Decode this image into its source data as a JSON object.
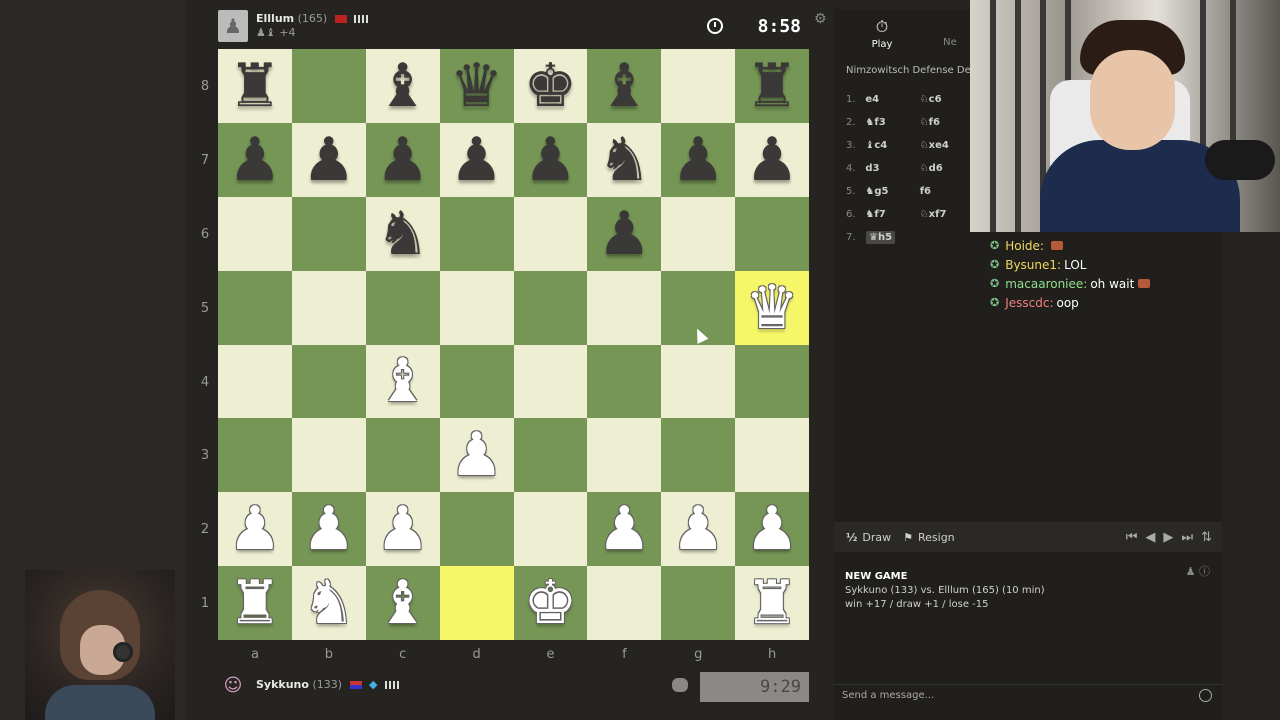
{
  "top_player": {
    "name": "Elllum",
    "rating": "(165)",
    "captures": "♟♝",
    "material": "+4"
  },
  "bottom_player": {
    "name": "Sykkuno",
    "rating": "(133)"
  },
  "clocks": {
    "top": "8:58",
    "bottom": "9:29"
  },
  "board": {
    "ranks": [
      "8",
      "7",
      "6",
      "5",
      "4",
      "3",
      "2",
      "1"
    ],
    "files": [
      "a",
      "b",
      "c",
      "d",
      "e",
      "f",
      "g",
      "h"
    ],
    "rows": [
      [
        "bR",
        "",
        "bB",
        "bQ",
        "bK",
        "bB",
        "",
        "bR"
      ],
      [
        "bP",
        "bP",
        "bP",
        "bP",
        "bP",
        "bN",
        "bP",
        "bP"
      ],
      [
        "",
        "",
        "bN",
        "",
        "",
        "bP",
        "",
        ""
      ],
      [
        "",
        "",
        "",
        "",
        "",
        "",
        "",
        "wQ"
      ],
      [
        "",
        "",
        "wB",
        "",
        "",
        "",
        "",
        ""
      ],
      [
        "",
        "",
        "",
        "wP",
        "",
        "",
        "",
        ""
      ],
      [
        "wP",
        "wP",
        "wP",
        "",
        "",
        "wP",
        "wP",
        "wP"
      ],
      [
        "wR",
        "wN",
        "wB",
        "",
        "wK",
        "",
        "",
        "wR"
      ]
    ],
    "highlights": [
      "h5",
      "d1"
    ]
  },
  "tabs": {
    "play": "Play",
    "new": "Ne"
  },
  "opening": "Nimzowitsch Defense Declin",
  "moves": [
    {
      "n": "1.",
      "w": "e4",
      "b": "♘c6"
    },
    {
      "n": "2.",
      "w": "♞f3",
      "b": "♘f6"
    },
    {
      "n": "3.",
      "w": "♝c4",
      "b": "♘xe4"
    },
    {
      "n": "4.",
      "w": "d3",
      "b": "♘d6"
    },
    {
      "n": "5.",
      "w": "♞g5",
      "b": "f6"
    },
    {
      "n": "6.",
      "w": "♞f7",
      "b": "♘xf7"
    },
    {
      "n": "7.",
      "w": "♛h5",
      "b": ""
    }
  ],
  "chat": [
    {
      "user": "Hoide:",
      "text": "",
      "color": "#f0d860",
      "brick": true
    },
    {
      "user": "Bysune1:",
      "text": "LOL",
      "color": "#f0d860",
      "brick": false
    },
    {
      "user": "macaaroniee:",
      "text": "oh wait",
      "color": "#8ee08e",
      "brick": true
    },
    {
      "user": "Jesscdc:",
      "text": "oop",
      "color": "#f08080",
      "brick": false
    }
  ],
  "controls": {
    "draw": "Draw",
    "draw_icon": "½",
    "resign": "Resign"
  },
  "game_info": {
    "title": "NEW GAME",
    "matchup": "Sykkuno (133) vs. Elllum (165) (10 min)",
    "stakes": "win +17 / draw +1 / lose -15"
  },
  "message_placeholder": "Send a message..."
}
